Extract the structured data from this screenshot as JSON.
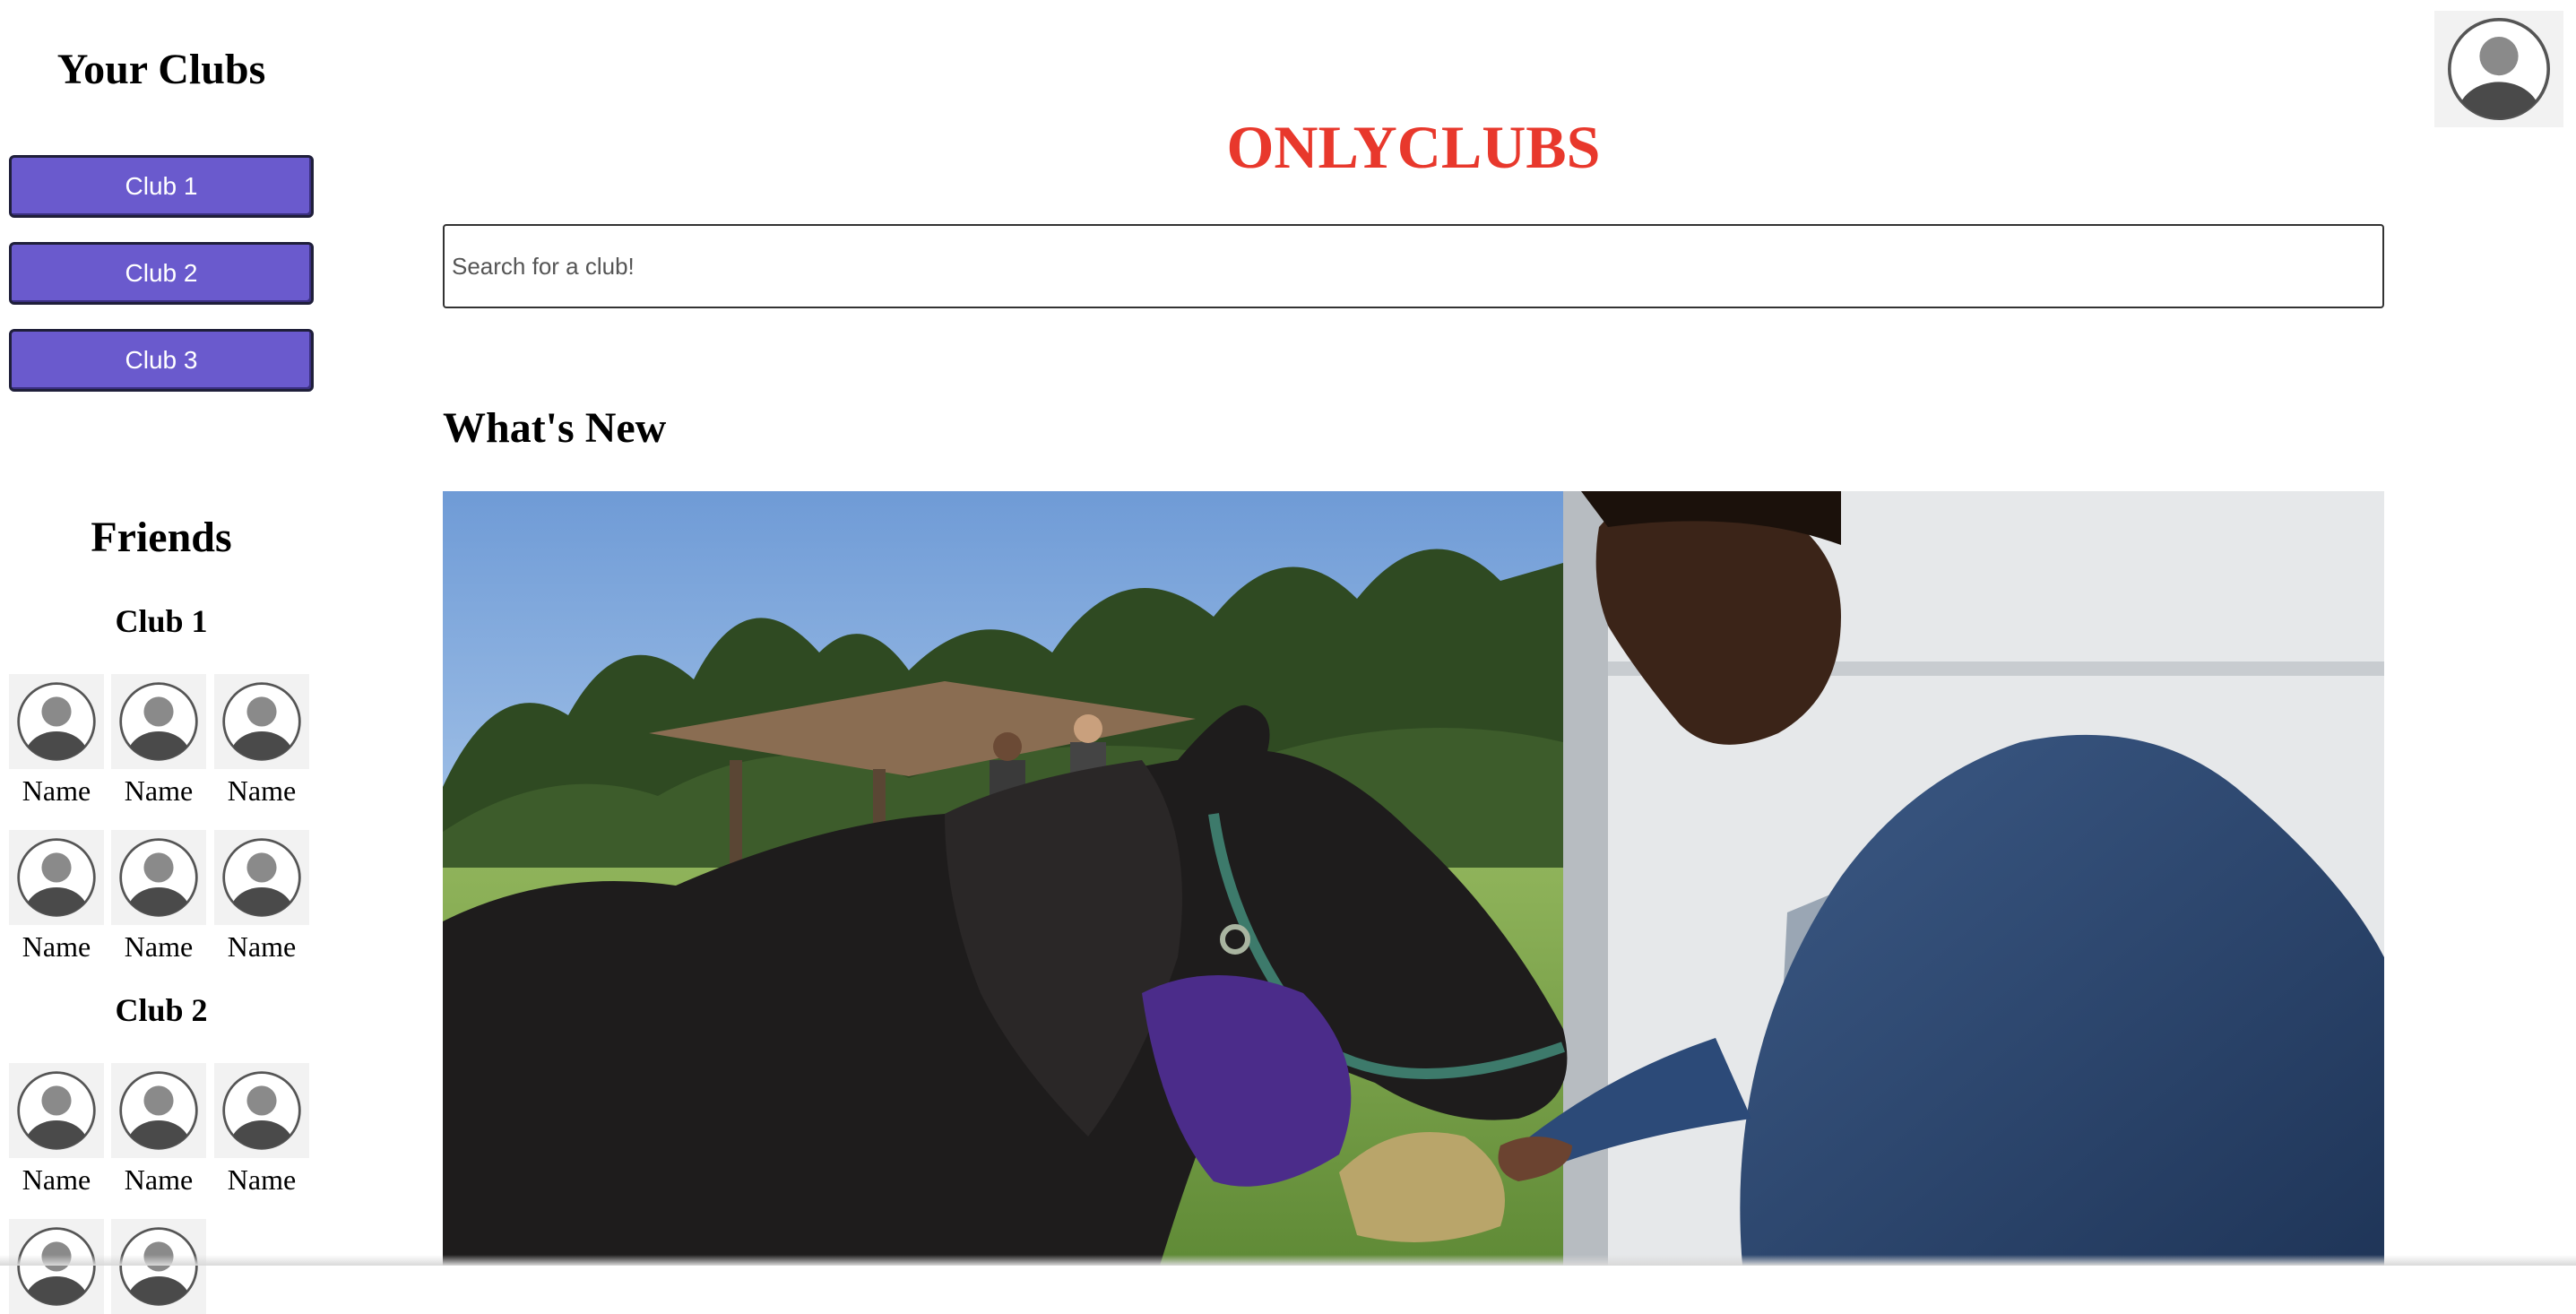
{
  "sidebar": {
    "your_clubs_title": "Your Clubs",
    "clubs": [
      {
        "label": "Club 1"
      },
      {
        "label": "Club 2"
      },
      {
        "label": "Club 3"
      }
    ],
    "friends_title": "Friends",
    "friend_groups": [
      {
        "title": "Club 1",
        "friends": [
          "Name",
          "Name",
          "Name",
          "Name",
          "Name",
          "Name"
        ]
      },
      {
        "title": "Club 2",
        "friends": [
          "Name",
          "Name",
          "Name"
        ]
      }
    ]
  },
  "header": {
    "brand": "ONLYCLUBS"
  },
  "search": {
    "placeholder": "Search for a club!",
    "value": ""
  },
  "feed": {
    "title": "What's New"
  },
  "colors": {
    "brand": "#e8382c",
    "club_button": "#6a5acd",
    "avatar_bg": "#f2f2f2"
  },
  "icons": {
    "profile": "user-avatar-icon",
    "friend": "user-avatar-icon"
  }
}
